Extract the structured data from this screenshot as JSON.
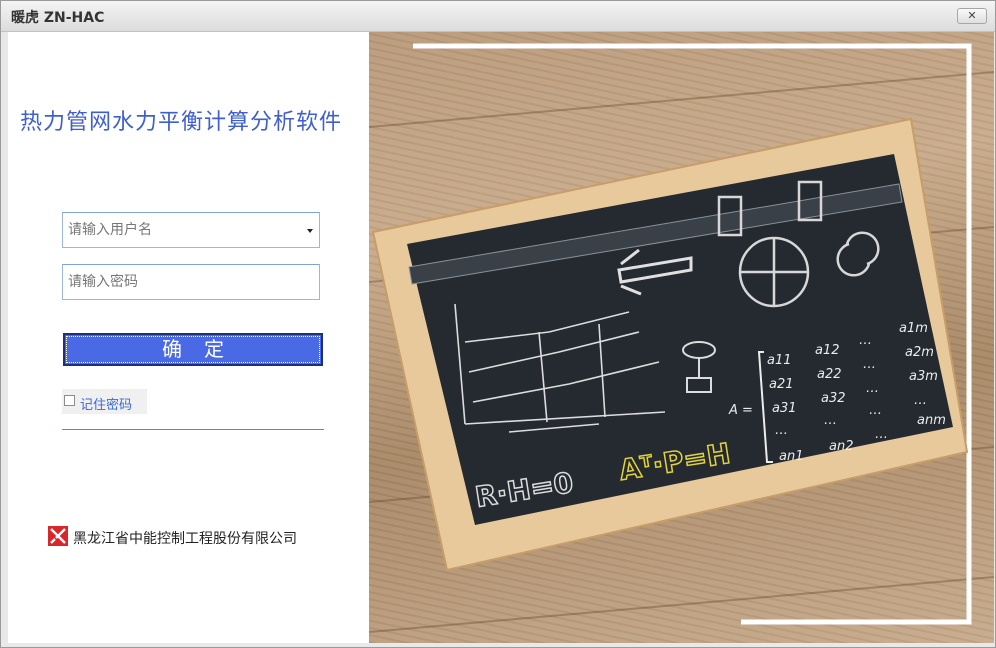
{
  "window": {
    "title": "暖虎 ZN-HAC",
    "close_icon": "✕"
  },
  "login": {
    "app_title": "热力管网水力平衡计算分析软件",
    "username_placeholder": "请输入用户名",
    "password_placeholder": "请输入密码",
    "confirm_label": "确定",
    "remember_label": "记住密码",
    "remember_checked": false
  },
  "company": {
    "name": "黑龙江省中能控制工程股份有限公司",
    "logo_color": "#d8262a"
  },
  "banner": {
    "formula_left": "R·H=0",
    "formula_right": "Aᵀ·P=H",
    "matrix_label": "A =",
    "matrix": [
      [
        "a11",
        "a12",
        "…",
        "a1m"
      ],
      [
        "a21",
        "a22",
        "…",
        "a2m"
      ],
      [
        "a31",
        "a32",
        "…",
        "a3m"
      ],
      [
        "…",
        "…",
        "…",
        "…"
      ],
      [
        "an1",
        "an2",
        "…",
        "anm"
      ]
    ]
  },
  "colors": {
    "accent": "#4a69e4",
    "title": "#3f5fce",
    "chalk": "#eeeeee",
    "formula_yellow": "#e2d33c"
  }
}
